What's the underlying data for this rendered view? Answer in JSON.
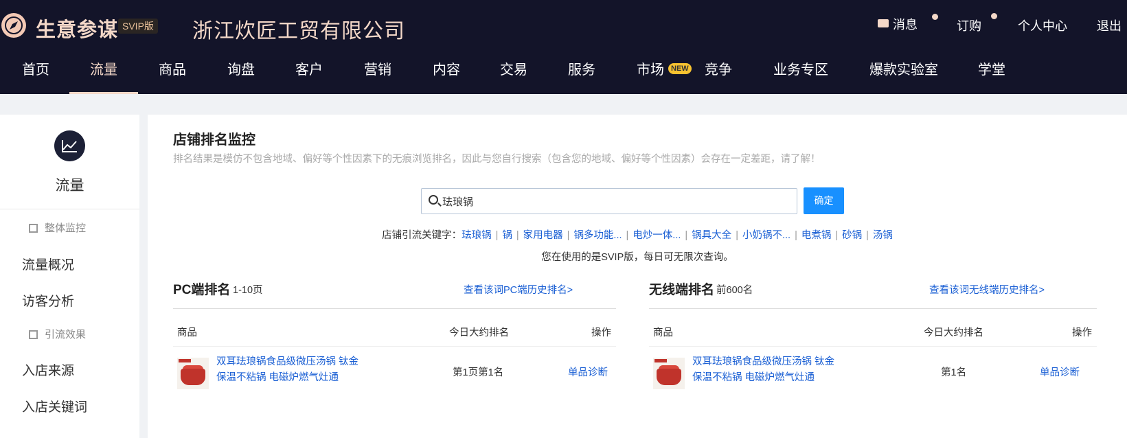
{
  "header": {
    "brand": "生意参谋",
    "badge": "SVIP版",
    "company": "浙江炊匠工贸有限公司",
    "links": {
      "messages": "消息",
      "subscribe": "订购",
      "profile": "个人中心",
      "logout": "退出"
    },
    "nav": [
      "首页",
      "流量",
      "商品",
      "询盘",
      "客户",
      "营销",
      "内容",
      "交易",
      "服务",
      "市场",
      "竞争",
      "业务专区",
      "爆款实验室",
      "学堂"
    ],
    "nav_active": "流量",
    "new_badge": "NEW"
  },
  "sidebar": {
    "title": "流量",
    "groups": [
      {
        "label": "整体监控",
        "items": [
          "流量概况",
          "访客分析"
        ]
      },
      {
        "label": "引流效果",
        "items": [
          "入店来源",
          "入店关键词"
        ]
      }
    ]
  },
  "main": {
    "title": "店铺排名监控",
    "subtitle": "排名结果是模仿不包含地域、偏好等个性因素下的无痕浏览排名，因此与您自行搜索（包含您的地域、偏好等个性因素）会存在一定差距，请了解！",
    "search": {
      "value": "珐琅锅",
      "button": "确定"
    },
    "keywords_label": "店铺引流关键字：",
    "keywords": [
      "珐琅锅",
      "锅",
      "家用电器",
      "锅多功能...",
      "电炒一体...",
      "锅具大全",
      "小奶锅不...",
      "电煮锅",
      "砂锅",
      "汤锅"
    ],
    "svip_note": "您在使用的是SVIP版，每日可无限次查询。",
    "pc": {
      "title": "PC端排名",
      "range": "1-10页",
      "history_link": "查看该词PC端历史排名>",
      "columns": {
        "product": "商品",
        "rank": "今日大约排名",
        "action": "操作"
      },
      "row": {
        "name": "双耳珐琅锅食品级微压汤锅 钛金保温不粘锅 电磁炉燃气灶通",
        "rank": "第1页第1名",
        "action": "单品诊断"
      }
    },
    "mobile": {
      "title": "无线端排名",
      "range": "前600名",
      "history_link": "查看该词无线端历史排名>",
      "columns": {
        "product": "商品",
        "rank": "今日大约排名",
        "action": "操作"
      },
      "row": {
        "name": "双耳珐琅锅食品级微压汤锅 钛金保温不粘锅 电磁炉燃气灶通",
        "rank": "第1名",
        "action": "单品诊断"
      }
    }
  },
  "colors": {
    "header_bg": "#131429",
    "accent": "#f4d8c8",
    "link": "#1a5fd4",
    "button": "#1890ff"
  }
}
